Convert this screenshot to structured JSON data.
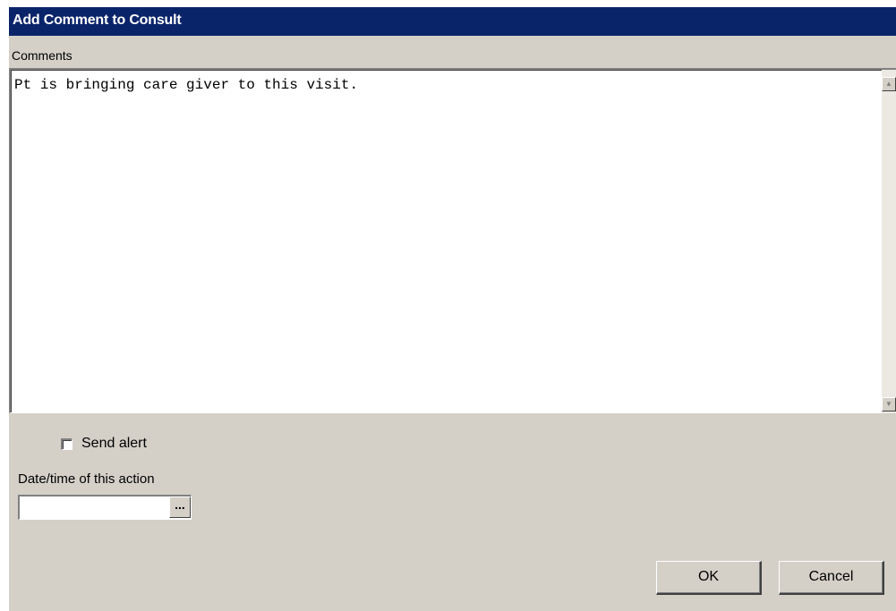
{
  "window": {
    "title": "Add Comment to Consult"
  },
  "comments": {
    "label": "Comments",
    "value": "Pt is bringing care giver to this visit."
  },
  "alert": {
    "label": "Send alert",
    "checked": false
  },
  "datetime": {
    "label": "Date/time of this action",
    "value": "",
    "button_label": "..."
  },
  "buttons": {
    "ok": "OK",
    "cancel": "Cancel"
  },
  "colors": {
    "titlebar": "#0a246a",
    "dialog_bg": "#d4d0c8"
  }
}
